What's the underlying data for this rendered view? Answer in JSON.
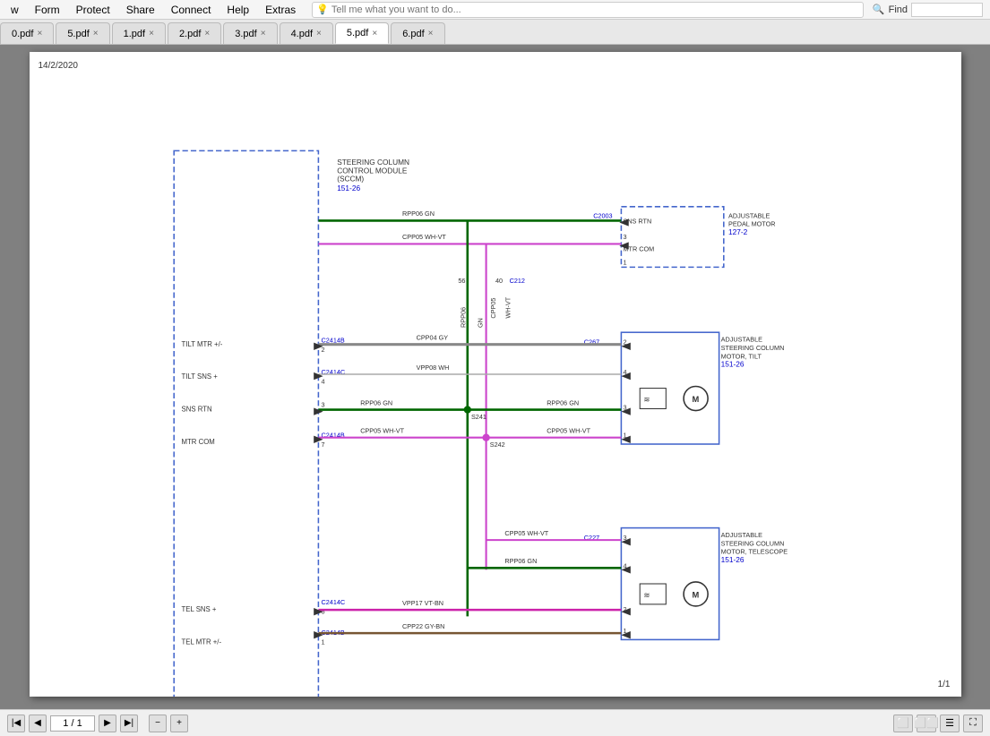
{
  "menubar": {
    "items": [
      "w",
      "Form",
      "Protect",
      "Share",
      "Connect",
      "Help",
      "Extras"
    ],
    "search_placeholder": "Tell me what you want to do...",
    "find_label": "Find",
    "find_placeholder": ""
  },
  "tabs": [
    {
      "label": "0.pdf",
      "active": false
    },
    {
      "label": "5.pdf",
      "active": false
    },
    {
      "label": "1.pdf",
      "active": false
    },
    {
      "label": "2.pdf",
      "active": false
    },
    {
      "label": "3.pdf",
      "active": false
    },
    {
      "label": "4.pdf",
      "active": false
    },
    {
      "label": "5.pdf",
      "active": true
    },
    {
      "label": "6.pdf",
      "active": false
    }
  ],
  "page": {
    "date": "14/2/2020",
    "page_number": "1/1",
    "page_input_value": "1 / 1"
  },
  "schematic": {
    "title_sccm": "STEERING COLUMN CONTROL MODULE (SCCM)",
    "title_sccm_ref": "151-26",
    "title_pedal": "ADJUSTABLE PEDAL MOTOR",
    "title_pedal_ref": "127-2",
    "title_tilt": "ADJUSTABLE STEERING COLUMN MOTOR, TILT",
    "title_tilt_ref": "151-26",
    "title_telescope": "ADJUSTABLE STEERING COLUMN MOTOR, TELESCOPE",
    "title_telescope_ref": "151-26"
  }
}
